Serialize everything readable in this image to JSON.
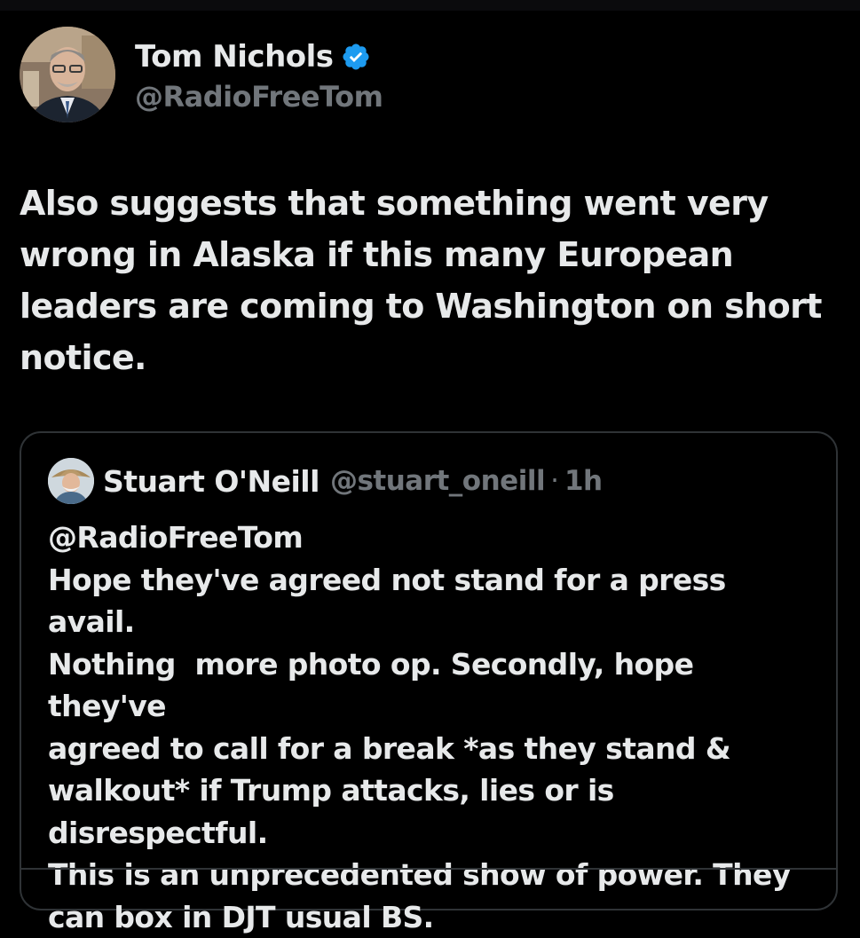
{
  "post": {
    "author": {
      "display_name": "Tom Nichols",
      "handle": "@RadioFreeTom",
      "verified": true,
      "avatar_icon": "avatar-photo-icon"
    },
    "text": "Also suggests that something went very\nwrong in Alaska if this many European\nleaders are coming to Washington on short\nnotice."
  },
  "quoted_post": {
    "author": {
      "display_name": "Stuart O'Neill",
      "handle": "@stuart_oneill",
      "avatar_icon": "avatar-photo-icon"
    },
    "separator": "·",
    "time": "1h",
    "text": "@RadioFreeTom\nHope they've agreed not stand for a press avail.\nNothing  more photo op. Secondly, hope they've\nagreed to call for a break *as they stand &\nwalkout* if Trump attacks, lies or is\ndisrespectful.\nThis is an unprecedented show of power. They\ncan box in DJT usual BS."
  },
  "colors": {
    "background": "#000000",
    "text_primary": "#e7e9ea",
    "text_secondary": "#71767b",
    "border": "#2f3336",
    "verified_badge": "#1d9bf0"
  }
}
